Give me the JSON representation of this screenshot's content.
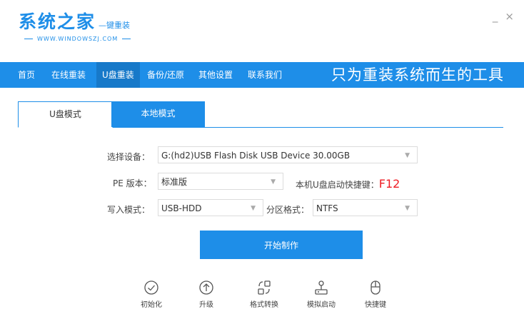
{
  "app": {
    "logo_main": "系统之家",
    "logo_sub": "—键重装",
    "logo_url": "WWW.WINDOWSZJ.COM"
  },
  "window": {
    "minimize": "_",
    "close": "×"
  },
  "nav": {
    "items": [
      "首页",
      "在线重装",
      "U盘重装",
      "备份/还原",
      "其他设置",
      "联系我们"
    ],
    "active_index": 2,
    "slogan": "只为重装系统而生的工具"
  },
  "tabs": {
    "usb_mode": "U盘模式",
    "local_mode": "本地模式"
  },
  "form": {
    "device_label": "选择设备：",
    "device_value": "G:(hd2)USB Flash Disk USB Device 30.00GB",
    "pe_label": "PE 版本：",
    "pe_value": "标准版",
    "hotkey_label": "本机U盘启动快捷键：",
    "hotkey_value": "F12",
    "write_label": "写入模式：",
    "write_value": "USB-HDD",
    "partition_label": "分区格式：",
    "partition_value": "NTFS"
  },
  "start_button": "开始制作",
  "tools": [
    "初始化",
    "升级",
    "格式转换",
    "模拟启动",
    "快捷键"
  ],
  "colors": {
    "accent": "#1e8ee8",
    "hotkey": "#ee1c24"
  }
}
